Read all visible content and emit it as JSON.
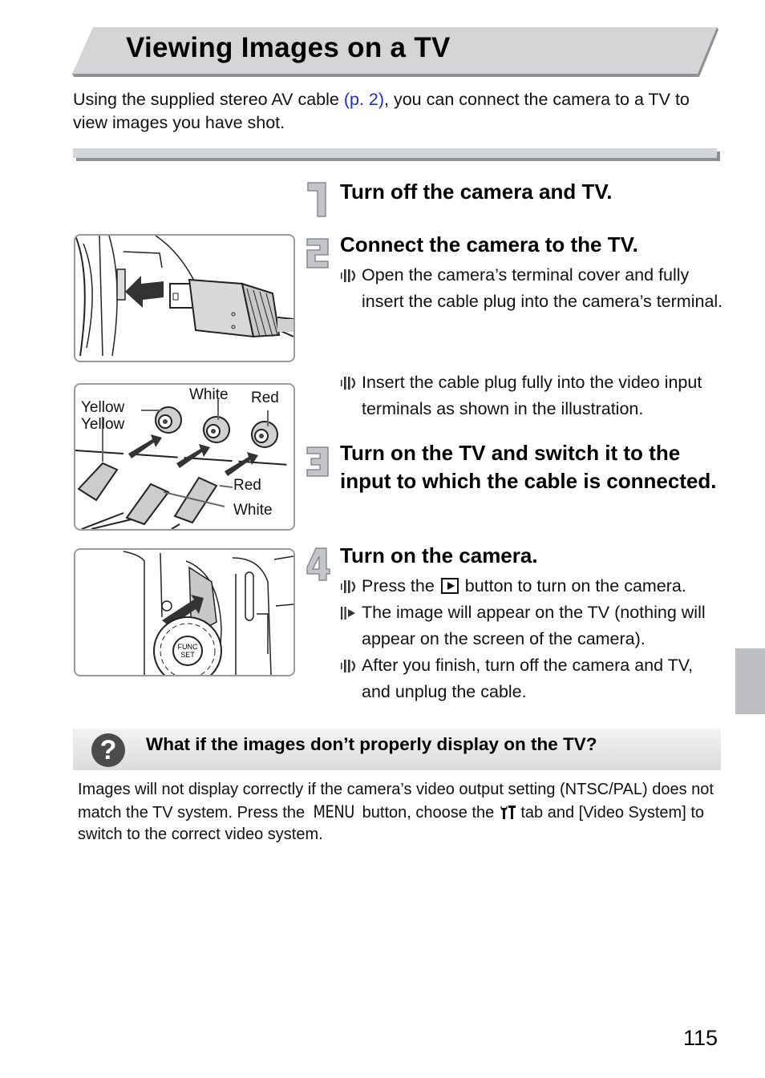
{
  "page": {
    "title": "Viewing Images on a TV",
    "intro": {
      "before_link": "Using the supplied stereo AV cable ",
      "link_text": "(p. 2)",
      "after_link": ", you can connect the camera to a TV to view images you have shot."
    },
    "page_number": "115",
    "colors": {
      "link": "#1a2bd9",
      "banner": "#d4d5d7",
      "banner_shadow": "#8f9093",
      "side_tab": "#bdbec1"
    }
  },
  "steps": [
    {
      "number": "1",
      "title": "Turn off the camera and TV.",
      "bullets": []
    },
    {
      "number": "2",
      "title": "Connect the camera to the TV.",
      "bullets": [
        {
          "icon": "operation-icon",
          "text": "Open the camera’s terminal cover and fully insert the cable plug into the camera’s terminal."
        },
        {
          "icon": "operation-icon",
          "text": "Insert the cable plug fully into the video input terminals as shown in the illustration."
        }
      ]
    },
    {
      "number": "3",
      "title": "Turn on the TV and switch it to the input to which the cable is connected.",
      "bullets": []
    },
    {
      "number": "4",
      "title": "Turn on the camera.",
      "bullets": [
        {
          "icon": "operation-icon",
          "before": "Press the ",
          "button_icon": "playback-button-icon",
          "after": " button to turn on the camera."
        },
        {
          "icon": "result-icon",
          "text": "The image will appear on the TV (nothing will appear on the screen of the camera)."
        },
        {
          "icon": "operation-icon",
          "text": "After you finish, turn off the camera and TV, and unplug the cable."
        }
      ]
    }
  ],
  "illustrations": {
    "cable_connection": {
      "alt": "camera terminal with cable plug being inserted"
    },
    "tv_terminals": {
      "labels": {
        "terminal_yellow": "Yellow",
        "terminal_white": "White",
        "terminal_red": "Red",
        "plug_yellow": "Yellow",
        "plug_red": "Red",
        "plug_white": "White"
      }
    },
    "playback_button": {
      "dial_label_1": "FUNC",
      "dial_label_2": "SET"
    }
  },
  "tip": {
    "icon": "question-icon",
    "title": "What if the images don’t properly display on the TV?",
    "body": {
      "part1": "Images will not display correctly if the camera’s video output setting (NTSC/PAL) does not match the TV system. Press the ",
      "menu_label": "MENU",
      "part2": " button, choose the ",
      "tab_icon": "tools-tab-icon",
      "part3": " tab and [Video System] to switch to the correct video system."
    }
  }
}
